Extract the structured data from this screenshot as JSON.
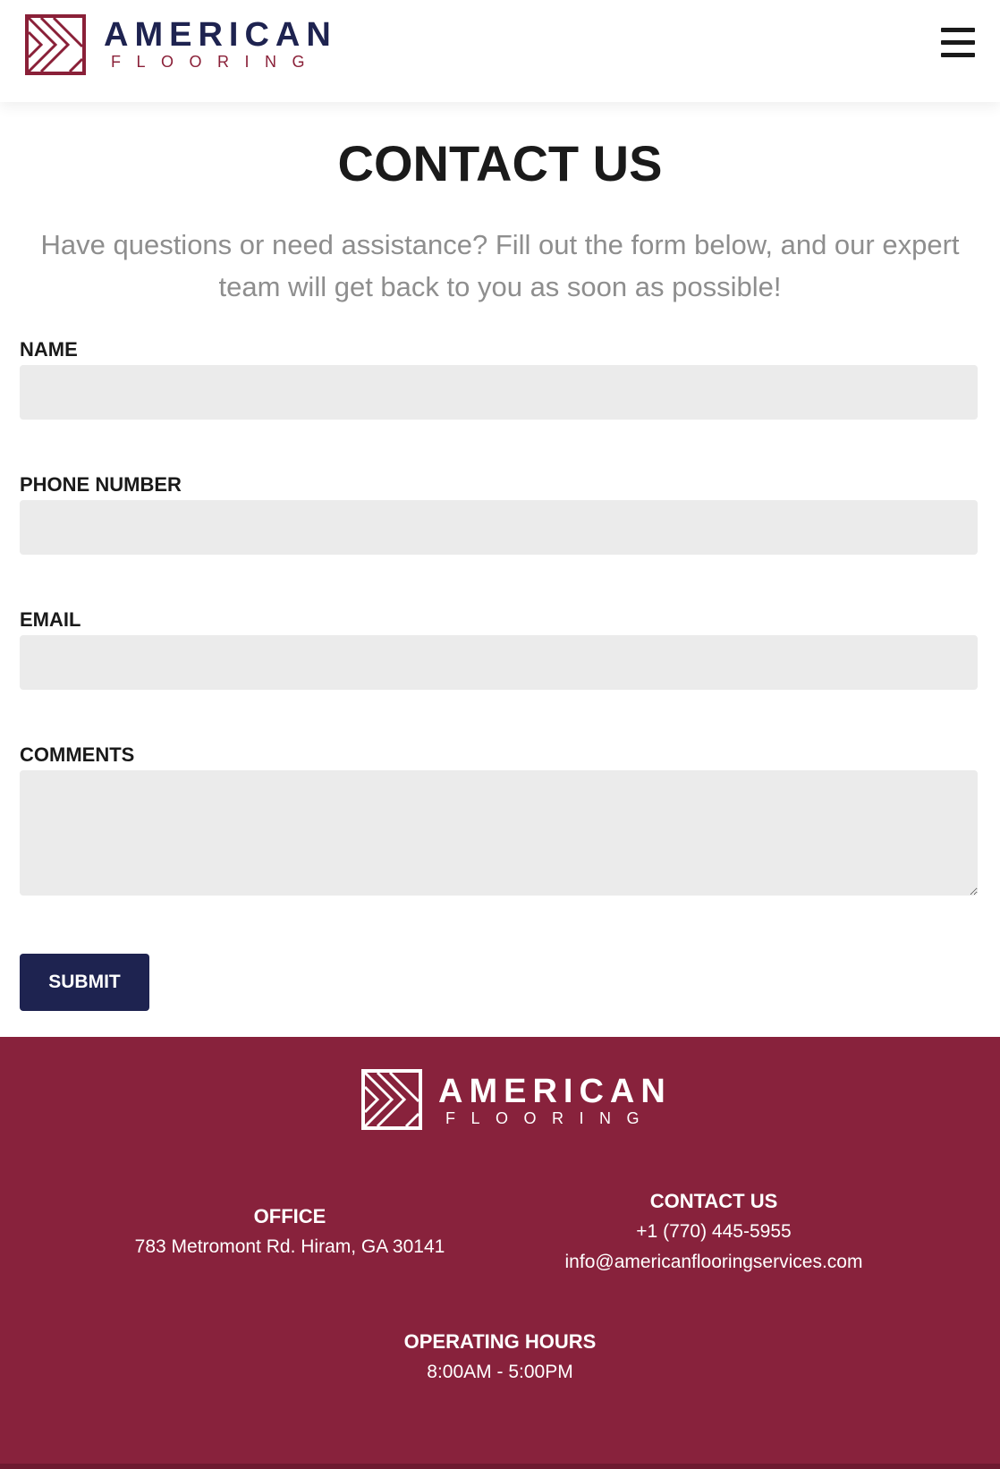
{
  "header": {
    "logo": {
      "word": "AMERICAN",
      "sub": "FLOORING",
      "mark_color": "#8a2038",
      "word_color": "#1e2350"
    },
    "menu_icon": "hamburger-menu-icon"
  },
  "main": {
    "title": "CONTACT US",
    "intro": "Have questions or need assistance? Fill out the form below, and our expert team will get back to you as soon as possible!",
    "form": {
      "name_label": "NAME",
      "name_value": "",
      "phone_label": "PHONE NUMBER",
      "phone_value": "",
      "email_label": "EMAIL",
      "email_value": "",
      "comments_label": "COMMENTS",
      "comments_value": "",
      "submit_label": "SUBMIT"
    }
  },
  "footer": {
    "background_color": "#88223c",
    "logo": {
      "word": "AMERICAN",
      "sub": "FLOORING"
    },
    "office": {
      "heading": "OFFICE",
      "address": "783 Metromont Rd. Hiram, GA 30141"
    },
    "contact": {
      "heading": "CONTACT US",
      "phone": "+1 (770) 445-5955",
      "email": "info@americanflooringservices.com"
    },
    "hours": {
      "heading": "OPERATING HOURS",
      "value": "8:00AM - 5:00PM"
    }
  },
  "colors": {
    "navy": "#1e2350",
    "maroon": "#88223c",
    "input_bg": "#ebebeb",
    "muted_text": "#8e8e8e"
  }
}
